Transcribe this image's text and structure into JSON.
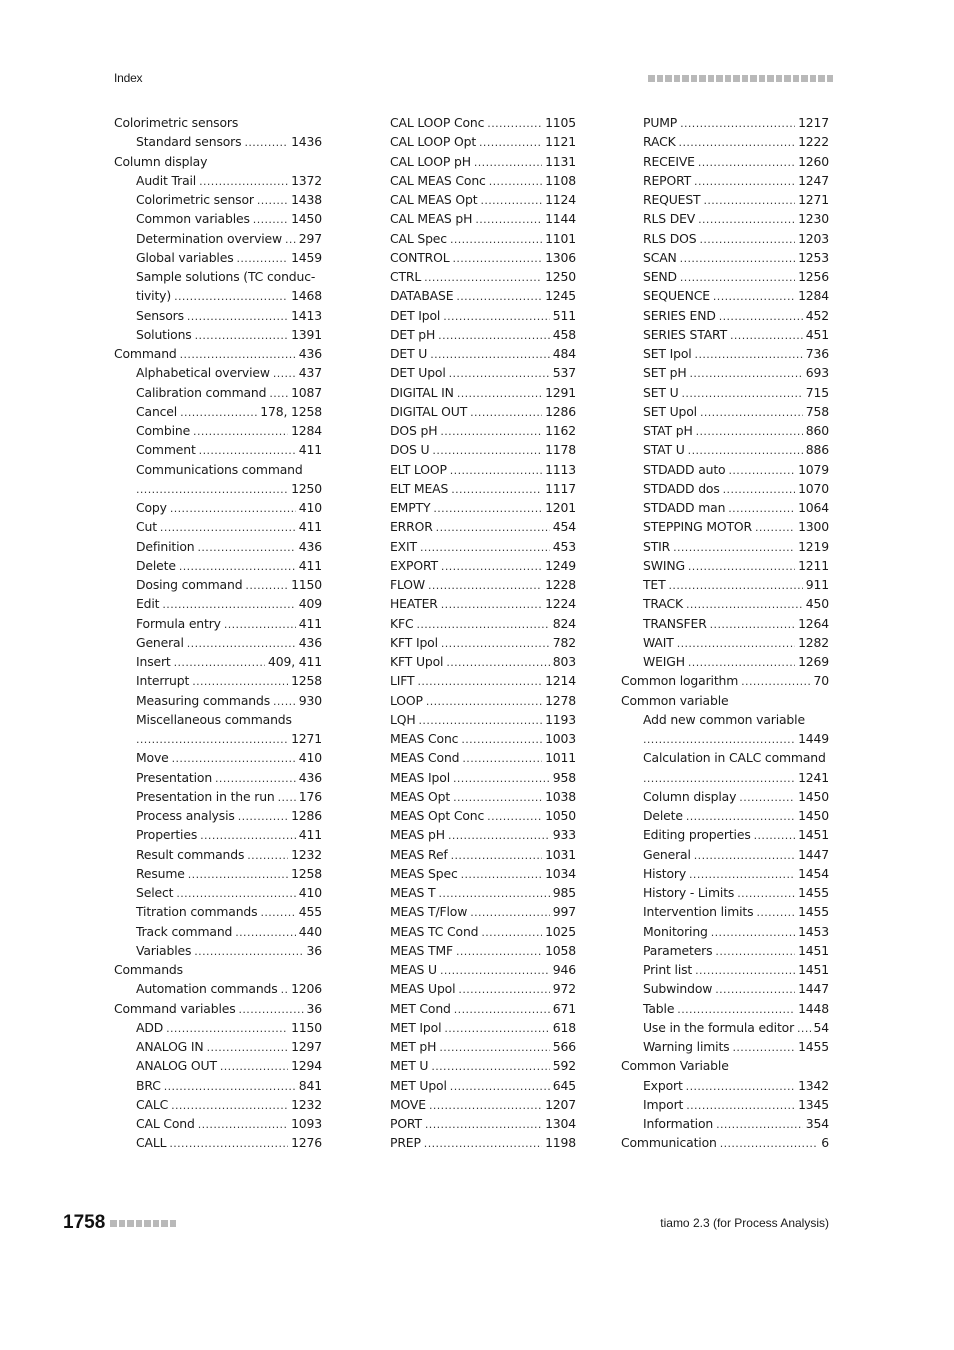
{
  "header": {
    "title": "Index",
    "square_count": 22
  },
  "footer": {
    "page_number": "1758",
    "product": "tiamo 2.3 (for Process Analysis)",
    "square_count": 8
  },
  "columns": [
    [
      {
        "term": "Colorimetric sensors",
        "page": "",
        "level": 0
      },
      {
        "term": "Standard sensors",
        "page": "1436",
        "level": 1
      },
      {
        "term": "Column display",
        "page": "",
        "level": 0
      },
      {
        "term": "Audit Trail",
        "page": "1372",
        "level": 1
      },
      {
        "term": "Colorimetric sensor",
        "page": "1438",
        "level": 1
      },
      {
        "term": "Common variables",
        "page": "1450",
        "level": 1
      },
      {
        "term": "Determination overview",
        "page": "297",
        "level": 1
      },
      {
        "term": "Global variables",
        "page": "1459",
        "level": 1
      },
      {
        "term": "Sample solutions (TC conduc-",
        "page": "",
        "level": 1
      },
      {
        "term": "tivity)",
        "page": "1468",
        "level": 1
      },
      {
        "term": "Sensors",
        "page": "1413",
        "level": 1
      },
      {
        "term": "Solutions",
        "page": "1391",
        "level": 1
      },
      {
        "term": "Command",
        "page": "436",
        "level": 0
      },
      {
        "term": "Alphabetical overview",
        "page": "437",
        "level": 1
      },
      {
        "term": "Calibration command",
        "page": "1087",
        "level": 1
      },
      {
        "term": "Cancel",
        "page": "178, 1258",
        "level": 1
      },
      {
        "term": "Combine",
        "page": "1284",
        "level": 1
      },
      {
        "term": "Comment",
        "page": "411",
        "level": 1
      },
      {
        "term": "Communications command",
        "page": "",
        "level": 1
      },
      {
        "term": "",
        "page": "1250",
        "level": 1
      },
      {
        "term": "Copy",
        "page": "410",
        "level": 1
      },
      {
        "term": "Cut",
        "page": "411",
        "level": 1
      },
      {
        "term": "Definition",
        "page": "436",
        "level": 1
      },
      {
        "term": "Delete",
        "page": "411",
        "level": 1
      },
      {
        "term": "Dosing command",
        "page": "1150",
        "level": 1
      },
      {
        "term": "Edit",
        "page": "409",
        "level": 1
      },
      {
        "term": "Formula entry",
        "page": "411",
        "level": 1
      },
      {
        "term": "General",
        "page": "436",
        "level": 1
      },
      {
        "term": "Insert",
        "page": "409, 411",
        "level": 1
      },
      {
        "term": "Interrupt",
        "page": "1258",
        "level": 1
      },
      {
        "term": "Measuring commands",
        "page": "930",
        "level": 1
      },
      {
        "term": "Miscellaneous commands",
        "page": "",
        "level": 1
      },
      {
        "term": "",
        "page": "1271",
        "level": 1
      },
      {
        "term": "Move",
        "page": "410",
        "level": 1
      },
      {
        "term": "Presentation",
        "page": "436",
        "level": 1
      },
      {
        "term": "Presentation in the run",
        "page": "176",
        "level": 1
      },
      {
        "term": "Process analysis",
        "page": "1286",
        "level": 1
      },
      {
        "term": "Properties",
        "page": "411",
        "level": 1
      },
      {
        "term": "Result commands",
        "page": "1232",
        "level": 1
      },
      {
        "term": "Resume",
        "page": "1258",
        "level": 1
      },
      {
        "term": "Select",
        "page": "410",
        "level": 1
      },
      {
        "term": "Titration commands",
        "page": "455",
        "level": 1
      },
      {
        "term": "Track command",
        "page": "440",
        "level": 1
      },
      {
        "term": "Variables",
        "page": "36",
        "level": 1
      },
      {
        "term": "Commands",
        "page": "",
        "level": 0
      },
      {
        "term": "Automation commands",
        "page": "1206",
        "level": 1
      },
      {
        "term": "Command variables",
        "page": "36",
        "level": 0
      },
      {
        "term": "ADD",
        "page": "1150",
        "level": 1
      },
      {
        "term": "ANALOG IN",
        "page": "1297",
        "level": 1
      },
      {
        "term": "ANALOG OUT",
        "page": "1294",
        "level": 1
      },
      {
        "term": "BRC",
        "page": "841",
        "level": 1
      },
      {
        "term": "CALC",
        "page": "1232",
        "level": 1
      },
      {
        "term": "CAL Cond",
        "page": "1093",
        "level": 1
      },
      {
        "term": "CALL",
        "page": "1276",
        "level": 1
      }
    ],
    [
      {
        "term": "CAL LOOP Conc",
        "page": "1105",
        "level": 0
      },
      {
        "term": "CAL LOOP Opt",
        "page": "1121",
        "level": 0
      },
      {
        "term": "CAL LOOP pH",
        "page": "1131",
        "level": 0
      },
      {
        "term": "CAL MEAS Conc",
        "page": "1108",
        "level": 0
      },
      {
        "term": "CAL MEAS Opt",
        "page": "1124",
        "level": 0
      },
      {
        "term": "CAL MEAS pH",
        "page": "1144",
        "level": 0
      },
      {
        "term": "CAL Spec",
        "page": "1101",
        "level": 0
      },
      {
        "term": "CONTROL",
        "page": "1306",
        "level": 0
      },
      {
        "term": "CTRL",
        "page": "1250",
        "level": 0
      },
      {
        "term": "DATABASE",
        "page": "1245",
        "level": 0
      },
      {
        "term": "DET Ipol",
        "page": "511",
        "level": 0
      },
      {
        "term": "DET pH",
        "page": "458",
        "level": 0
      },
      {
        "term": "DET U",
        "page": "484",
        "level": 0
      },
      {
        "term": "DET Upol",
        "page": "537",
        "level": 0
      },
      {
        "term": "DIGITAL IN",
        "page": "1291",
        "level": 0
      },
      {
        "term": "DIGITAL OUT",
        "page": "1286",
        "level": 0
      },
      {
        "term": "DOS pH",
        "page": "1162",
        "level": 0
      },
      {
        "term": "DOS U",
        "page": "1178",
        "level": 0
      },
      {
        "term": "ELT LOOP",
        "page": "1113",
        "level": 0
      },
      {
        "term": "ELT MEAS",
        "page": "1117",
        "level": 0
      },
      {
        "term": "EMPTY",
        "page": "1201",
        "level": 0
      },
      {
        "term": "ERROR",
        "page": "454",
        "level": 0
      },
      {
        "term": "EXIT",
        "page": "453",
        "level": 0
      },
      {
        "term": "EXPORT",
        "page": "1249",
        "level": 0
      },
      {
        "term": "FLOW",
        "page": "1228",
        "level": 0
      },
      {
        "term": "HEATER",
        "page": "1224",
        "level": 0
      },
      {
        "term": "KFC",
        "page": "824",
        "level": 0
      },
      {
        "term": "KFT Ipol",
        "page": "782",
        "level": 0
      },
      {
        "term": "KFT Upol",
        "page": "803",
        "level": 0
      },
      {
        "term": "LIFT",
        "page": "1214",
        "level": 0
      },
      {
        "term": "LOOP",
        "page": "1278",
        "level": 0
      },
      {
        "term": "LQH",
        "page": "1193",
        "level": 0
      },
      {
        "term": "MEAS Conc",
        "page": "1003",
        "level": 0
      },
      {
        "term": "MEAS Cond",
        "page": "1011",
        "level": 0
      },
      {
        "term": "MEAS Ipol",
        "page": "958",
        "level": 0
      },
      {
        "term": "MEAS Opt",
        "page": "1038",
        "level": 0
      },
      {
        "term": "MEAS Opt Conc",
        "page": "1050",
        "level": 0
      },
      {
        "term": "MEAS pH",
        "page": "933",
        "level": 0
      },
      {
        "term": "MEAS Ref",
        "page": "1031",
        "level": 0
      },
      {
        "term": "MEAS Spec",
        "page": "1034",
        "level": 0
      },
      {
        "term": "MEAS T",
        "page": "985",
        "level": 0
      },
      {
        "term": "MEAS T/Flow",
        "page": "997",
        "level": 0
      },
      {
        "term": "MEAS TC Cond",
        "page": "1025",
        "level": 0
      },
      {
        "term": "MEAS TMF",
        "page": "1058",
        "level": 0
      },
      {
        "term": "MEAS U",
        "page": "946",
        "level": 0
      },
      {
        "term": "MEAS Upol",
        "page": "972",
        "level": 0
      },
      {
        "term": "MET Cond",
        "page": "671",
        "level": 0
      },
      {
        "term": "MET Ipol",
        "page": "618",
        "level": 0
      },
      {
        "term": "MET pH",
        "page": "566",
        "level": 0
      },
      {
        "term": "MET U",
        "page": "592",
        "level": 0
      },
      {
        "term": "MET Upol",
        "page": "645",
        "level": 0
      },
      {
        "term": "MOVE",
        "page": "1207",
        "level": 0
      },
      {
        "term": "PORT",
        "page": "1304",
        "level": 0
      },
      {
        "term": "PREP",
        "page": "1198",
        "level": 0
      }
    ],
    [
      {
        "term": "PUMP",
        "page": "1217",
        "level": 1
      },
      {
        "term": "RACK",
        "page": "1222",
        "level": 1
      },
      {
        "term": "RECEIVE",
        "page": "1260",
        "level": 1
      },
      {
        "term": "REPORT",
        "page": "1247",
        "level": 1
      },
      {
        "term": "REQUEST",
        "page": "1271",
        "level": 1
      },
      {
        "term": "RLS DEV",
        "page": "1230",
        "level": 1
      },
      {
        "term": "RLS DOS",
        "page": "1203",
        "level": 1
      },
      {
        "term": "SCAN",
        "page": "1253",
        "level": 1
      },
      {
        "term": "SEND",
        "page": "1256",
        "level": 1
      },
      {
        "term": "SEQUENCE",
        "page": "1284",
        "level": 1
      },
      {
        "term": "SERIES END",
        "page": "452",
        "level": 1
      },
      {
        "term": "SERIES START",
        "page": "451",
        "level": 1
      },
      {
        "term": "SET Ipol",
        "page": "736",
        "level": 1
      },
      {
        "term": "SET pH",
        "page": "693",
        "level": 1
      },
      {
        "term": "SET U",
        "page": "715",
        "level": 1
      },
      {
        "term": "SET Upol",
        "page": "758",
        "level": 1
      },
      {
        "term": "STAT pH",
        "page": "860",
        "level": 1
      },
      {
        "term": "STAT U",
        "page": "886",
        "level": 1
      },
      {
        "term": "STDADD auto",
        "page": "1079",
        "level": 1
      },
      {
        "term": "STDADD dos",
        "page": "1070",
        "level": 1
      },
      {
        "term": "STDADD man",
        "page": "1064",
        "level": 1
      },
      {
        "term": "STEPPING MOTOR",
        "page": "1300",
        "level": 1
      },
      {
        "term": "STIR",
        "page": "1219",
        "level": 1
      },
      {
        "term": "SWING",
        "page": "1211",
        "level": 1
      },
      {
        "term": "TET",
        "page": "911",
        "level": 1
      },
      {
        "term": "TRACK",
        "page": "450",
        "level": 1
      },
      {
        "term": "TRANSFER",
        "page": "1264",
        "level": 1
      },
      {
        "term": "WAIT",
        "page": "1282",
        "level": 1
      },
      {
        "term": "WEIGH",
        "page": "1269",
        "level": 1
      },
      {
        "term": "Common logarithm",
        "page": "70",
        "level": 0
      },
      {
        "term": "Common variable",
        "page": "",
        "level": 0
      },
      {
        "term": "Add new common variable",
        "page": "",
        "level": 1
      },
      {
        "term": "",
        "page": "1449",
        "level": 1
      },
      {
        "term": "Calculation in CALC command",
        "page": "",
        "level": 1
      },
      {
        "term": "",
        "page": "1241",
        "level": 1
      },
      {
        "term": "Column display",
        "page": "1450",
        "level": 1
      },
      {
        "term": "Delete",
        "page": "1450",
        "level": 1
      },
      {
        "term": "Editing properties",
        "page": "1451",
        "level": 1
      },
      {
        "term": "General",
        "page": "1447",
        "level": 1
      },
      {
        "term": "History",
        "page": "1454",
        "level": 1
      },
      {
        "term": "History - Limits",
        "page": "1455",
        "level": 1
      },
      {
        "term": "Intervention limits",
        "page": "1455",
        "level": 1
      },
      {
        "term": "Monitoring",
        "page": "1453",
        "level": 1
      },
      {
        "term": "Parameters",
        "page": "1451",
        "level": 1
      },
      {
        "term": "Print list",
        "page": "1451",
        "level": 1
      },
      {
        "term": "Subwindow",
        "page": "1447",
        "level": 1
      },
      {
        "term": "Table",
        "page": "1448",
        "level": 1
      },
      {
        "term": "Use in the formula editor",
        "page": "54",
        "level": 1
      },
      {
        "term": "Warning limits",
        "page": "1455",
        "level": 1
      },
      {
        "term": "Common Variable",
        "page": "",
        "level": 0
      },
      {
        "term": "Export",
        "page": "1342",
        "level": 1
      },
      {
        "term": "Import",
        "page": "1345",
        "level": 1
      },
      {
        "term": "Information",
        "page": "354",
        "level": 1
      },
      {
        "term": "Communication",
        "page": "6",
        "level": 0
      }
    ]
  ]
}
